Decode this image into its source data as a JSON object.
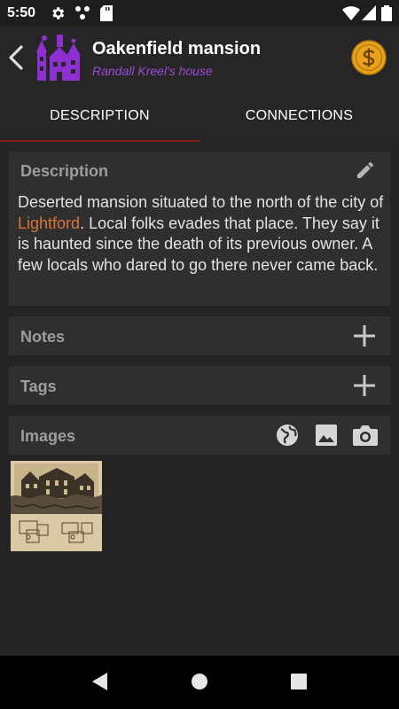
{
  "status_bar": {
    "time": "5:50",
    "icons": [
      "gear-icon",
      "network-dots-icon",
      "sd-card-icon",
      "wifi-icon",
      "signal-icon",
      "battery-icon"
    ]
  },
  "app_bar": {
    "title": "Oakenfield mansion",
    "subtitle": "Randall Kreel's house",
    "back_icon": "back-arrow-icon",
    "place_icon": "haunted-house-icon",
    "coin_icon": "dollar-coin-icon",
    "colors": {
      "subtitle": "#9a4bd8",
      "coin": "#e8a21c",
      "place_icon": "#8e2fd1"
    }
  },
  "tabs": [
    {
      "label": "DESCRIPTION",
      "active": true
    },
    {
      "label": "CONNECTIONS",
      "active": false
    }
  ],
  "description": {
    "header": "Description",
    "text_before": "Deserted mansion situated to the north of the city of ",
    "link_text": "Lightford",
    "text_after": ". Local folks evades that place. They say it is haunted since the death of its previous owner. A few locals who dared to go there never came back.",
    "edit_icon": "pencil-icon",
    "link_color": "#d6753a"
  },
  "notes": {
    "header": "Notes",
    "action_icon": "plus-icon"
  },
  "tags": {
    "header": "Tags",
    "action_icon": "plus-icon"
  },
  "images": {
    "header": "Images",
    "action_icons": [
      "globe-icon",
      "gallery-icon",
      "camera-icon"
    ],
    "thumbnails": [
      "mansion-sketch-thumbnail"
    ]
  },
  "nav_bar": {
    "buttons": [
      "back-triangle-icon",
      "home-circle-icon",
      "recents-square-icon"
    ]
  }
}
